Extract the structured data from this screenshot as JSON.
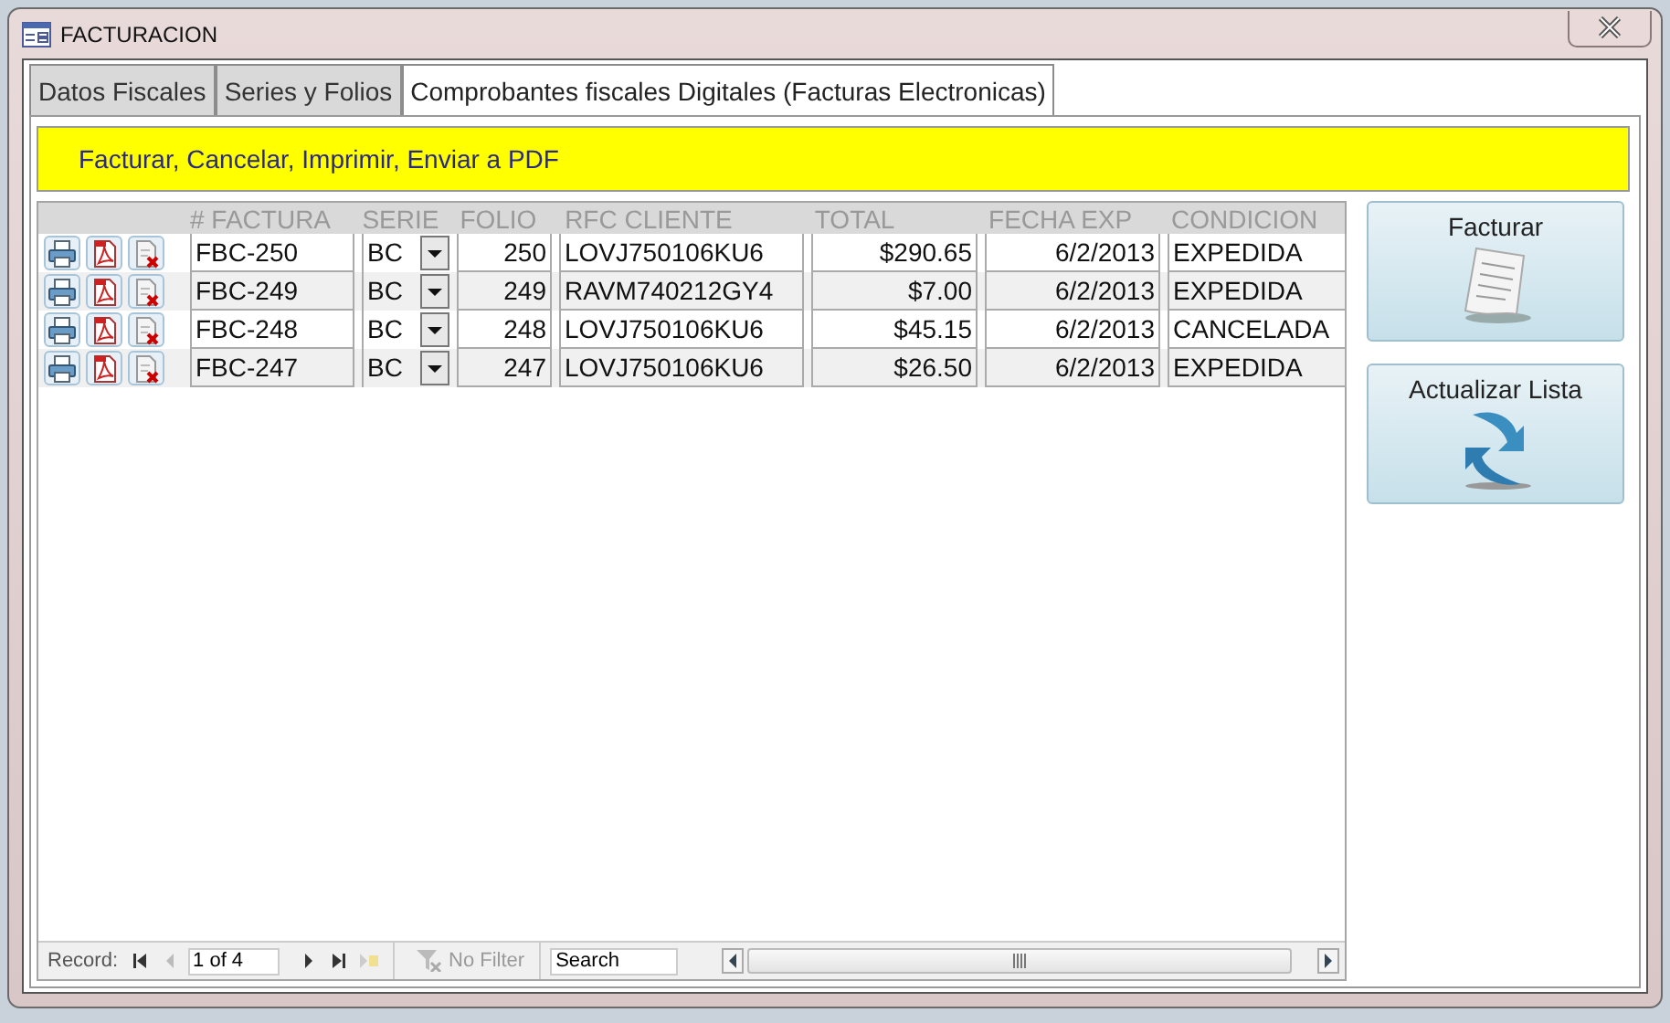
{
  "window": {
    "title": "FACTURACION"
  },
  "tabs": [
    {
      "label": "Datos Fiscales",
      "selected": false
    },
    {
      "label": "Series y Folios",
      "selected": false
    },
    {
      "label": "Comprobantes fiscales Digitales (Facturas Electronicas)",
      "selected": true
    }
  ],
  "banner": {
    "text": "Facturar, Cancelar, Imprimir, Enviar a PDF"
  },
  "table": {
    "columns": [
      "# FACTURA",
      "SERIE",
      "FOLIO",
      "RFC CLIENTE",
      "TOTAL",
      "FECHA EXP",
      "CONDICION"
    ],
    "rows": [
      {
        "factura": "FBC-250",
        "serie": "BC",
        "folio": "250",
        "rfc_cliente": "LOVJ750106KU6",
        "total": "$290.65",
        "fecha_exp": "6/2/2013",
        "condicion": "EXPEDIDA"
      },
      {
        "factura": "FBC-249",
        "serie": "BC",
        "folio": "249",
        "rfc_cliente": "RAVM740212GY4",
        "total": "$7.00",
        "fecha_exp": "6/2/2013",
        "condicion": "EXPEDIDA"
      },
      {
        "factura": "FBC-248",
        "serie": "BC",
        "folio": "248",
        "rfc_cliente": "LOVJ750106KU6",
        "total": "$45.15",
        "fecha_exp": "6/2/2013",
        "condicion": "CANCELADA"
      },
      {
        "factura": "FBC-247",
        "serie": "BC",
        "folio": "247",
        "rfc_cliente": "LOVJ750106KU6",
        "total": "$26.50",
        "fecha_exp": "6/2/2013",
        "condicion": "EXPEDIDA"
      }
    ]
  },
  "buttons": [
    {
      "label": "Facturar",
      "kind": "invoice"
    },
    {
      "label": "Actualizar Lista",
      "kind": "refresh"
    }
  ],
  "navigation": {
    "label": "Record:",
    "position": "1 of 4",
    "filter": "No Filter",
    "search": {
      "placeholder": "Search"
    }
  }
}
